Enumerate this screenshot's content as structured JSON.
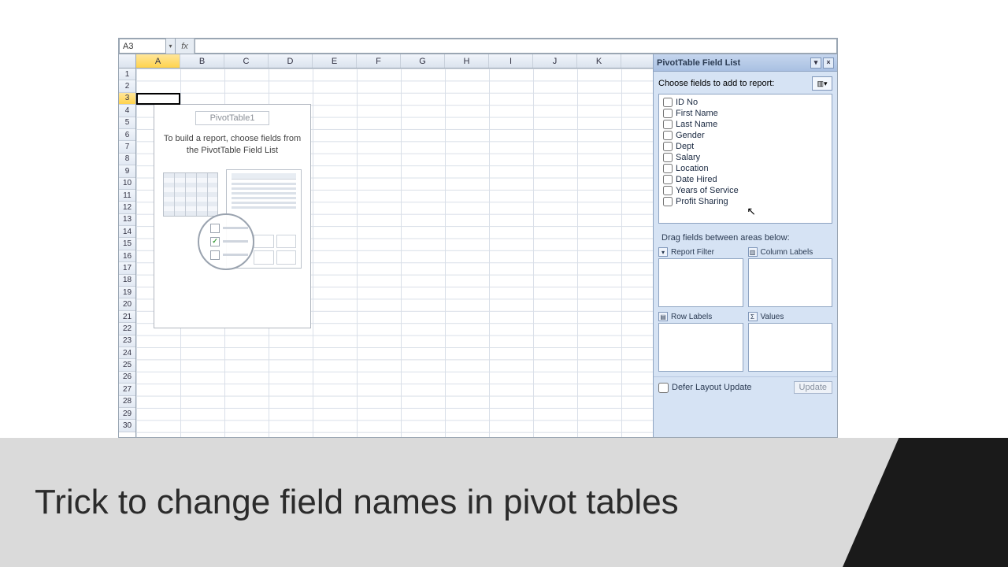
{
  "slide": {
    "title": "Trick to change field names in pivot tables"
  },
  "formula_bar": {
    "name_box": "A3",
    "fx": "fx",
    "formula": ""
  },
  "columns": [
    "A",
    "B",
    "C",
    "D",
    "E",
    "F",
    "G",
    "H",
    "I",
    "J",
    "K"
  ],
  "rows": [
    "1",
    "2",
    "3",
    "4",
    "5",
    "6",
    "7",
    "8",
    "9",
    "10",
    "11",
    "12",
    "13",
    "14",
    "15",
    "16",
    "17",
    "18",
    "19",
    "20",
    "21",
    "22",
    "23",
    "24",
    "25",
    "26",
    "27",
    "28",
    "29",
    "30"
  ],
  "active_column": "A",
  "active_row": "3",
  "pivot_placeholder": {
    "title": "PivotTable1",
    "instructions": "To build a report, choose fields from the PivotTable Field List"
  },
  "fieldlist": {
    "pane_title": "PivotTable Field List",
    "choose_label": "Choose fields to add to report:",
    "fields": [
      "ID No",
      "First Name",
      "Last Name",
      "Gender",
      "Dept",
      "Salary",
      "Location",
      "Date Hired",
      "Years of Service",
      "Profit Sharing"
    ],
    "drag_label": "Drag fields between areas below:",
    "areas": {
      "report_filter": "Report Filter",
      "column_labels": "Column Labels",
      "row_labels": "Row Labels",
      "values": "Values"
    },
    "defer_label": "Defer Layout Update",
    "update_btn": "Update"
  }
}
